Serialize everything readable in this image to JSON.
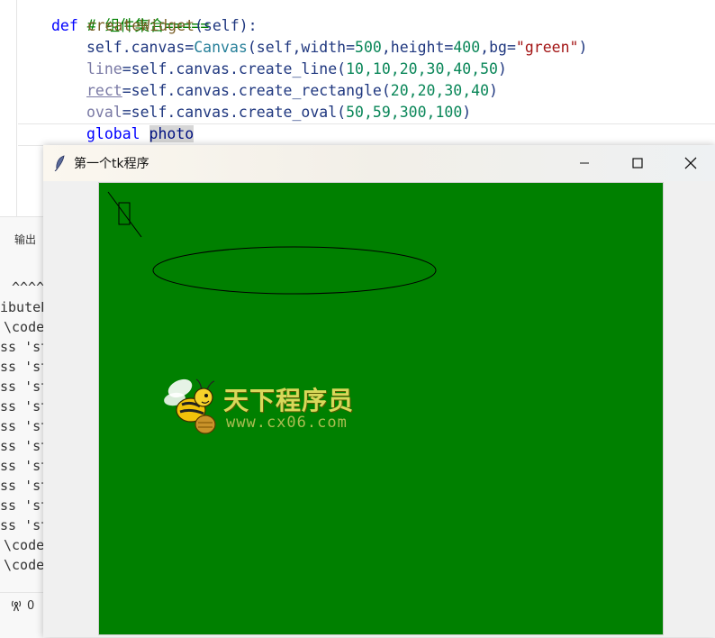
{
  "editor": {
    "line1": "# 组件集合=====",
    "line2_kw": "def",
    "line2_fn": "createWidget",
    "line2_arg": "(self):",
    "line3_a": "self.canvas=",
    "line3_cls": "Canvas",
    "line3_b": "(self,width=",
    "line3_n1": "500",
    "line3_c": ",height=",
    "line3_n2": "400",
    "line3_d": ",bg=",
    "line3_s": "\"green\"",
    "line3_e": ")",
    "line4_var": "line",
    "line4_a": "=self.canvas.create_line(",
    "line4_nums": "10,10,20,30,40,50",
    "line4_e": ")",
    "line5_var": "rect",
    "line5_a": "=self.canvas.create_rectangle(",
    "line5_nums": "20,20,30,40",
    "line5_e": ")",
    "line6_var": "oval",
    "line6_a": "=self.canvas.create_oval(",
    "line6_nums": "50,59,300,100",
    "line6_e": ")",
    "line7_kw": "global",
    "line7_var": "photo"
  },
  "panel": {
    "tab": "输出",
    "lines": [
      "^^^^",
      "ibuteE",
      "\\code",
      "ss 'st",
      "ss 'st",
      "ss 'st",
      "ss 'st",
      "ss 'st",
      "ss 'st",
      "ss 'st",
      "ss 'st",
      "ss 'st",
      "ss 'st",
      "\\code",
      "\\code"
    ],
    "status_count": "0"
  },
  "window": {
    "title": "第一个tk程序",
    "canvas_bg": "#008000"
  },
  "watermark": {
    "brand": "天下程序员",
    "url": "www.cx06.com"
  }
}
